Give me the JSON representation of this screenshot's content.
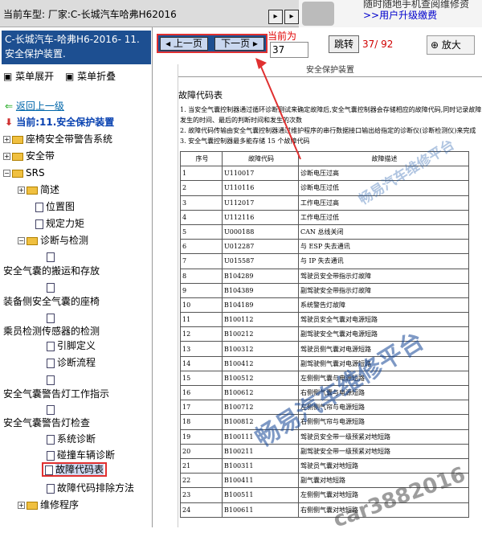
{
  "topbar": {
    "car_label": "当前车型: 厂家:C-长城汽车哈弗H62016",
    "ad_line1": "随时随地手机查阅维修资",
    "ad_line2": ">>用户升级缴费"
  },
  "left": {
    "header_title": "C-长城汽车-哈弗H6-2016- 11.安全保护装置.",
    "expand_label": "菜单展开",
    "collapse_label": "菜单折叠"
  },
  "tree": {
    "back": "返回上一级",
    "current": "当前:11.安全保护装置",
    "seat": "座椅安全带警告系统",
    "belt": "安全带",
    "srs": "SRS",
    "overview": "简述",
    "location": "位置图",
    "torque": "规定力矩",
    "diag": "诊断与检测",
    "handling": "安全气囊的搬运和存放",
    "side": "装备侧安全气囊的座椅",
    "occupant": "乘员检测传感器的检测",
    "pin": "引脚定义",
    "flow": "诊断流程",
    "lamp_op": "安全气囊警告灯工作指示",
    "lamp_chk": "安全气囊警告灯检查",
    "sysdiag": "系统诊断",
    "crash": "碰撞车辆诊断",
    "dtc_table": "故障代码表",
    "dtc_fix": "故障代码排除方法",
    "repair": "维修程序"
  },
  "toolbar": {
    "prev": "上一页",
    "next": "下一页",
    "current_label": "当前为",
    "current_page": "37",
    "jump": "跳转",
    "page_count": "37/ 92",
    "zoom": "放大"
  },
  "doc": {
    "header": "安全保护装置",
    "title": "故障代码表",
    "notes": [
      "1.  当安全气囊控制器通过循环诊断测试来确定故障后,安全气囊控制器会存储相应的故障代码,同时记录故障发生的时间、最后的判断时间和发生的次数",
      "2.  故障代码传输由安全气囊控制器通过维护程序的串行数据接口输出给指定的诊断仪(诊断检测仪)来完成",
      "3.  安全气囊控制器最多能存储 15 个故障代码"
    ],
    "cols": [
      "序号",
      "故障代码",
      "故障描述"
    ],
    "rows": [
      [
        "1",
        "U110017",
        "诊断电压过高"
      ],
      [
        "2",
        "U110116",
        "诊断电压过低"
      ],
      [
        "3",
        "U112017",
        "工作电压过高"
      ],
      [
        "4",
        "U112116",
        "工作电压过低"
      ],
      [
        "5",
        "U000188",
        "CAN 总线关闭"
      ],
      [
        "6",
        "U012287",
        "与 ESP 失去通讯"
      ],
      [
        "7",
        "U015587",
        "与 IP 失去通讯"
      ],
      [
        "8",
        "B104289",
        "驾驶员安全带指示灯故障"
      ],
      [
        "9",
        "B104389",
        "副驾驶安全带指示灯故障"
      ],
      [
        "10",
        "B104189",
        "系统警告灯故障"
      ],
      [
        "11",
        "B100112",
        "驾驶员安全气囊对电源短路"
      ],
      [
        "12",
        "B100212",
        "副驾驶安全气囊对电源短路"
      ],
      [
        "13",
        "B100312",
        "驾驶员侧气囊对电源短路"
      ],
      [
        "14",
        "B100412",
        "副驾驶侧气囊对电源短路"
      ],
      [
        "15",
        "B100512",
        "左侧侧气囊与电源短路"
      ],
      [
        "16",
        "B100612",
        "右侧侧气囊与电源短路"
      ],
      [
        "17",
        "B100712",
        "左侧侧气帘与电源短路"
      ],
      [
        "18",
        "B100812",
        "右侧侧气帘与电源短路"
      ],
      [
        "19",
        "B100111",
        "驾驶员安全带一级预紧对地短路"
      ],
      [
        "20",
        "B100211",
        "副驾驶安全带一级预紧对地短路"
      ],
      [
        "21",
        "B100311",
        "驾驶员气囊对地短路"
      ],
      [
        "22",
        "B100411",
        "副气囊对地短路"
      ],
      [
        "23",
        "B100511",
        "左侧侧气囊对地短路"
      ],
      [
        "24",
        "B100611",
        "右侧侧气囊对地短路"
      ]
    ]
  },
  "watermarks": {
    "w1": "畅易汽车维修平台",
    "w2": "畅易汽车维修平台",
    "w3": "car3882016"
  }
}
